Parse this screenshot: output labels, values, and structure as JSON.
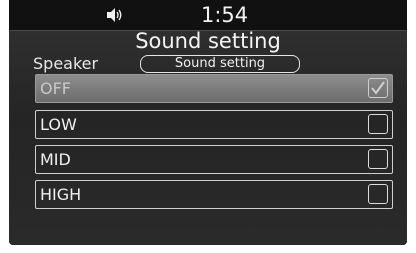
{
  "status_bar": {
    "clock": "1:54",
    "volume_icon": "speaker-volume-icon"
  },
  "screen": {
    "title": "Sound setting",
    "speaker_label": "Speaker",
    "setting_button_label": "Sound setting"
  },
  "options": [
    {
      "label": "OFF",
      "checked": true
    },
    {
      "label": "LOW",
      "checked": false
    },
    {
      "label": "MID",
      "checked": false
    },
    {
      "label": "HIGH",
      "checked": false
    }
  ]
}
